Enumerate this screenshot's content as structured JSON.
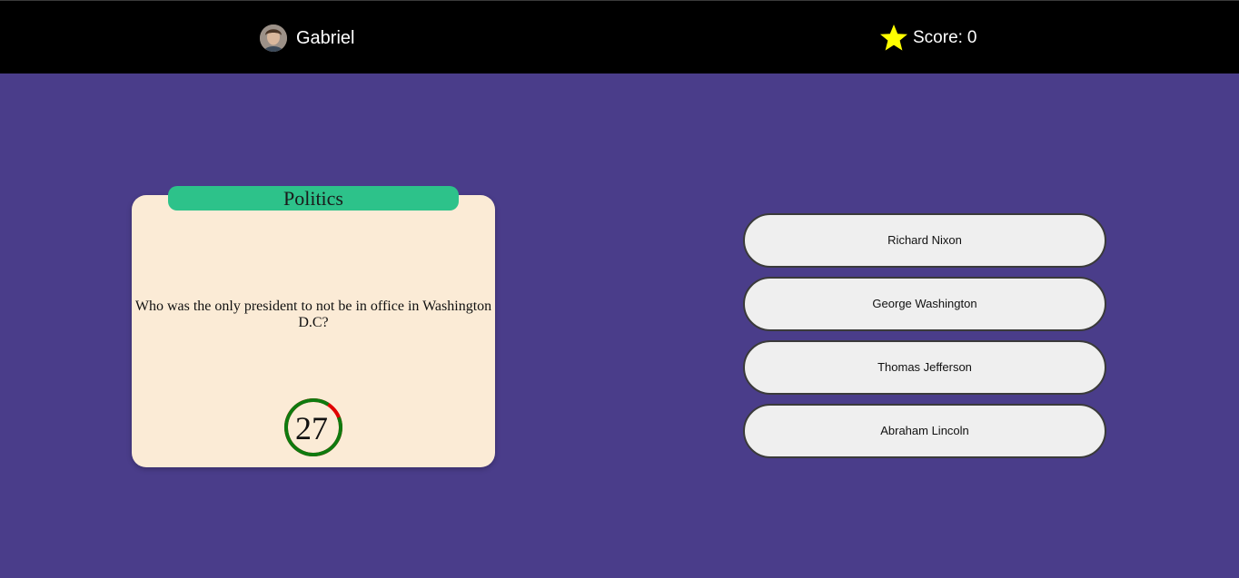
{
  "header": {
    "player_name": "Gabriel",
    "score_label": "Score:",
    "score_value": "0",
    "icons": [
      "avatar",
      "star-icon"
    ],
    "colors": {
      "bar": "#000000",
      "star": "#ffff00"
    }
  },
  "question_card": {
    "category": "Politics",
    "question": "Who was the only president to not be in office in Washington D.C?",
    "timer_seconds": "27",
    "timer_remaining_fraction": 0.9,
    "colors": {
      "card": "#fbebd6",
      "category": "#2dc28a",
      "timer_ring": "#0f7a0f",
      "timer_elapsed": "#e00000"
    }
  },
  "answers": [
    {
      "label": "Richard Nixon"
    },
    {
      "label": "George Washington"
    },
    {
      "label": "Thomas Jefferson"
    },
    {
      "label": "Abraham Lincoln"
    }
  ],
  "theme": {
    "background": "#4a3d8a"
  }
}
